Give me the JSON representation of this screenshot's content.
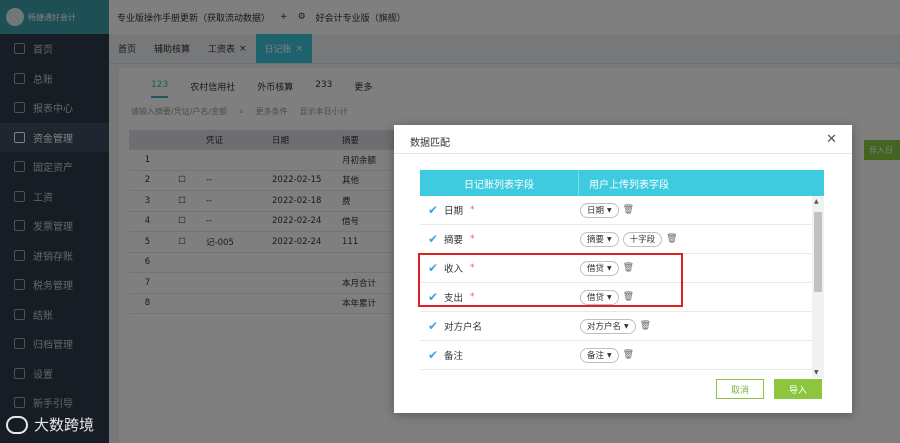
{
  "app": {
    "logo_text": "畅捷通好会计"
  },
  "sidebar": {
    "items": [
      {
        "label": "首页"
      },
      {
        "label": "总账"
      },
      {
        "label": "报表中心"
      },
      {
        "label": "资金管理"
      },
      {
        "label": "固定资产"
      },
      {
        "label": "工资"
      },
      {
        "label": "发票管理"
      },
      {
        "label": "进销存账"
      },
      {
        "label": "税务管理"
      },
      {
        "label": "结账"
      },
      {
        "label": "归档管理"
      },
      {
        "label": "设置"
      },
      {
        "label": "新手引导"
      }
    ]
  },
  "topbar": {
    "notice": "专业版操作手册更新（获取流动数据）",
    "add": "+",
    "version": "好会计专业版（旗舰）"
  },
  "tabs": [
    {
      "label": "首页"
    },
    {
      "label": "辅助核算"
    },
    {
      "label": "工资表"
    },
    {
      "label": "日记账"
    }
  ],
  "subtabs": [
    {
      "label": "123"
    },
    {
      "label": "农村信用社"
    },
    {
      "label": "外币核算"
    },
    {
      "label": "233"
    },
    {
      "label": "更多"
    }
  ],
  "filters": {
    "search_placeholder": "请输入摘要/凭证/户名/金额",
    "more": "更多条件",
    "daily_subtotal": "显示本日小计"
  },
  "import_top": "导入日",
  "grid": {
    "headers": [
      "",
      "",
      "凭证",
      "日期",
      "摘要"
    ],
    "rows": [
      {
        "n": "1",
        "voucher": "",
        "date": "",
        "summary": "月初余额"
      },
      {
        "n": "2",
        "voucher": "--",
        "date": "2022-02-15",
        "summary": "其他"
      },
      {
        "n": "3",
        "voucher": "--",
        "date": "2022-02-18",
        "summary": "费"
      },
      {
        "n": "4",
        "voucher": "--",
        "date": "2022-02-24",
        "summary": "借号"
      },
      {
        "n": "5",
        "voucher": "记-005",
        "date": "2022-02-24",
        "summary": "111"
      },
      {
        "n": "6",
        "voucher": "",
        "date": "",
        "summary": ""
      },
      {
        "n": "7",
        "voucher": "",
        "date": "",
        "summary": "本月合计"
      },
      {
        "n": "8",
        "voucher": "",
        "date": "",
        "summary": "本年累计"
      }
    ]
  },
  "dialog": {
    "title": "数据匹配",
    "col1": "日记账列表字段",
    "col2": "用户上传列表字段",
    "rows": [
      {
        "field": "日期",
        "required": "*",
        "select": "日期"
      },
      {
        "field": "摘要",
        "required": "*",
        "select": "摘要",
        "extra": "十字段"
      },
      {
        "field": "收入",
        "required": "*",
        "select": "借贷"
      },
      {
        "field": "支出",
        "required": "*",
        "select": "借贷"
      },
      {
        "field": "对方户名",
        "required": "",
        "select": "对方户名"
      },
      {
        "field": "备注",
        "required": "",
        "select": "备注"
      }
    ],
    "cancel": "取消",
    "import": "导入"
  },
  "watermark": "大数跨境"
}
